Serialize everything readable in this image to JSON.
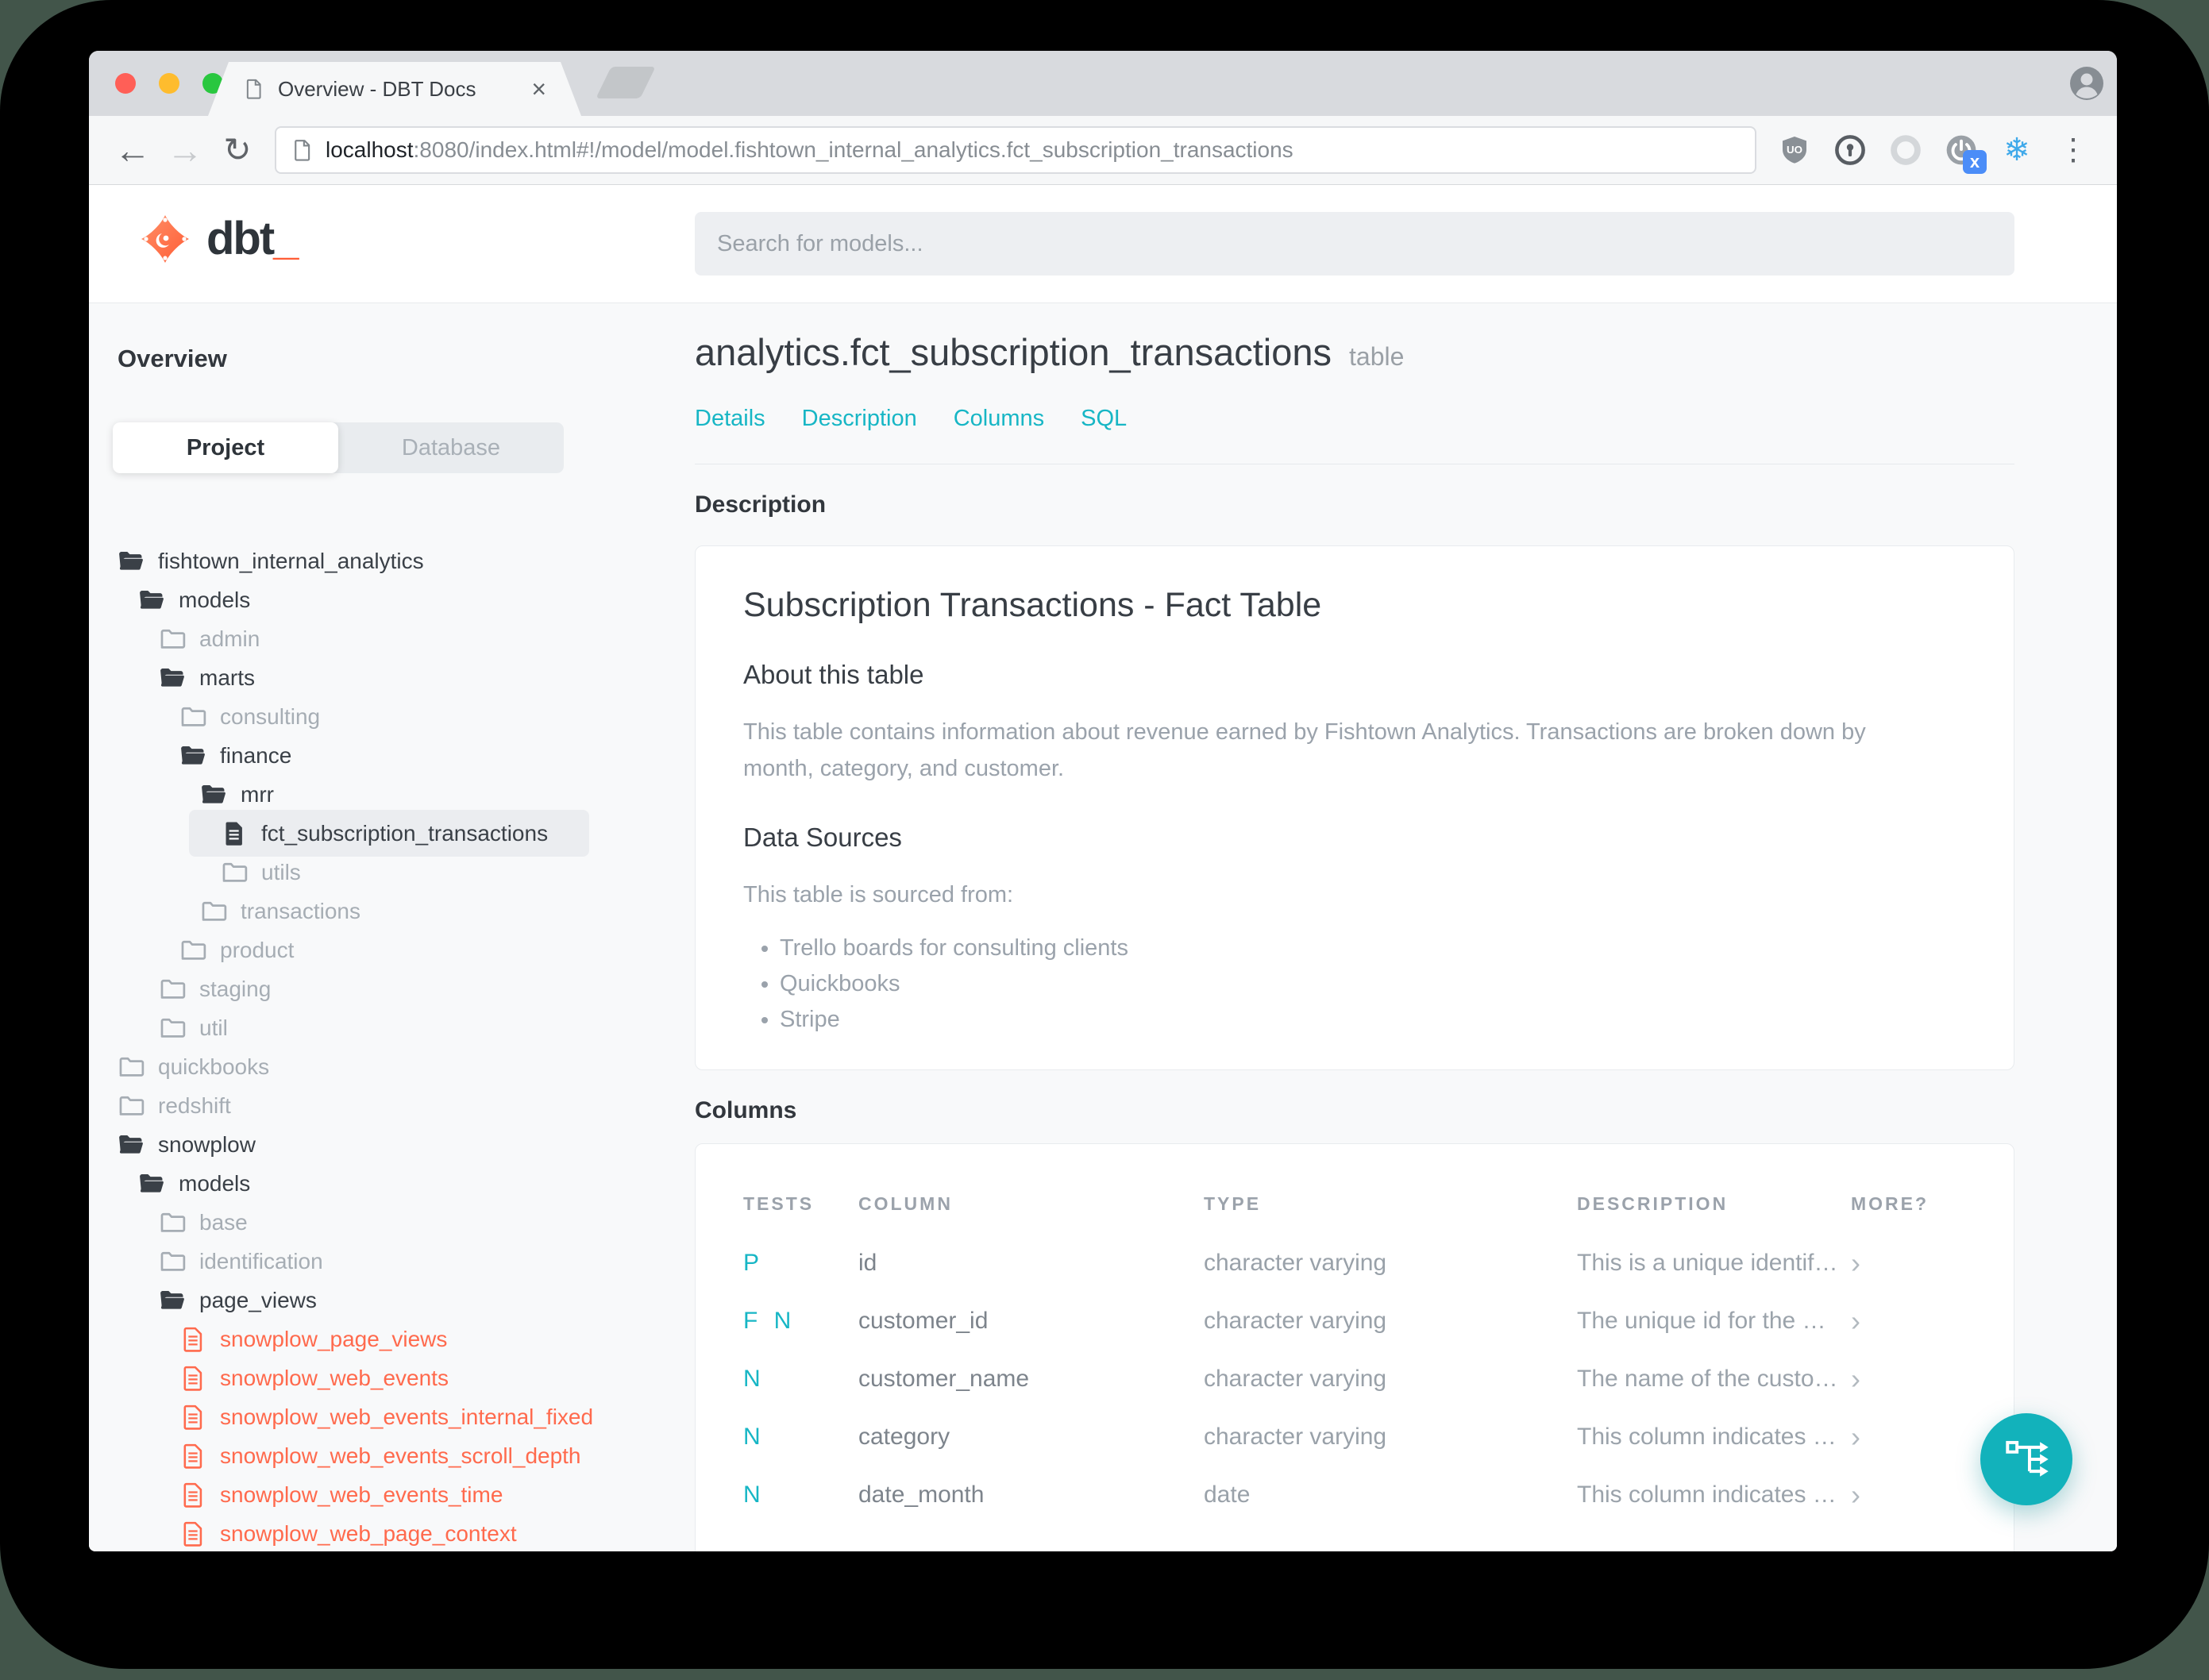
{
  "colors": {
    "accent_teal": "#17b6c5",
    "brand_orange": "#ff5c35",
    "model_red": "#ff6a4d",
    "selected_row_bg": "#ebedf0"
  },
  "icons": {
    "back": "←",
    "forward": "→",
    "reload": "↻",
    "tab_close": "×",
    "menu": "⋮",
    "snowflake": "❄",
    "row_chevron": "›",
    "ext_badge": "x",
    "ublock_label": "UO"
  },
  "browser": {
    "tab_title": "Overview - DBT Docs",
    "url_host": "localhost",
    "url_rest": ":8080/index.html#!/model/model.fishtown_internal_analytics.fct_subscription_transactions"
  },
  "header": {
    "logo_text": "dbt",
    "logo_underscore": "_",
    "search_placeholder": "Search for models..."
  },
  "sidebar": {
    "overview_label": "Overview",
    "tabs": {
      "project": "Project",
      "database": "Database"
    },
    "tree": [
      {
        "label": "fishtown_internal_analytics",
        "icon": "folder-open",
        "level": 0
      },
      {
        "label": "models",
        "icon": "folder-open",
        "level": 1
      },
      {
        "label": "admin",
        "icon": "folder-closed",
        "level": 2
      },
      {
        "label": "marts",
        "icon": "folder-open",
        "level": 2
      },
      {
        "label": "consulting",
        "icon": "folder-closed",
        "level": 3
      },
      {
        "label": "finance",
        "icon": "folder-open",
        "level": 3
      },
      {
        "label": "mrr",
        "icon": "folder-open",
        "level": 4
      },
      {
        "label": "fct_subscription_transactions",
        "icon": "file",
        "level": 5,
        "selected": true
      },
      {
        "label": "utils",
        "icon": "folder-closed",
        "level": 5
      },
      {
        "label": "transactions",
        "icon": "folder-closed",
        "level": 4
      },
      {
        "label": "product",
        "icon": "folder-closed",
        "level": 3
      },
      {
        "label": "staging",
        "icon": "folder-closed",
        "level": 2
      },
      {
        "label": "util",
        "icon": "folder-closed",
        "level": 2
      },
      {
        "label": "quickbooks",
        "icon": "folder-closed",
        "level": 0
      },
      {
        "label": "redshift",
        "icon": "folder-closed",
        "level": 0
      },
      {
        "label": "snowplow",
        "icon": "folder-open",
        "level": 0
      },
      {
        "label": "models",
        "icon": "folder-open",
        "level": 1
      },
      {
        "label": "base",
        "icon": "folder-closed",
        "level": 2
      },
      {
        "label": "identification",
        "icon": "folder-closed",
        "level": 2
      },
      {
        "label": "page_views",
        "icon": "folder-open",
        "level": 2
      },
      {
        "label": "snowplow_page_views",
        "icon": "file-red",
        "level": 3
      },
      {
        "label": "snowplow_web_events",
        "icon": "file-red",
        "level": 3
      },
      {
        "label": "snowplow_web_events_internal_fixed",
        "icon": "file-red",
        "level": 3
      },
      {
        "label": "snowplow_web_events_scroll_depth",
        "icon": "file-red",
        "level": 3
      },
      {
        "label": "snowplow_web_events_time",
        "icon": "file-red",
        "level": 3
      },
      {
        "label": "snowplow_web_page_context",
        "icon": "file-red",
        "level": 3
      }
    ]
  },
  "main": {
    "title": "analytics.fct_subscription_transactions",
    "title_badge": "table",
    "nav_tabs": [
      "Details",
      "Description",
      "Columns",
      "SQL"
    ],
    "description_section": {
      "heading": "Description",
      "card_title": "Subscription Transactions - Fact Table",
      "about_heading": "About this table",
      "about_text": "This table contains information about revenue earned by Fishtown Analytics. Transactions are broken down by month, category, and customer.",
      "sources_heading": "Data Sources",
      "sources_intro": "This table is sourced from:",
      "sources": [
        "Trello boards for consulting clients",
        "Quickbooks",
        "Stripe"
      ]
    },
    "columns_section": {
      "heading": "Columns",
      "table_headers": [
        "TESTS",
        "COLUMN",
        "TYPE",
        "DESCRIPTION",
        "MORE?"
      ],
      "rows": [
        {
          "tests": "P",
          "column": "id",
          "type": "character varying",
          "description": "This is a unique identif…"
        },
        {
          "tests": "F N",
          "column": "customer_id",
          "type": "character varying",
          "description": "The unique id for the …"
        },
        {
          "tests": "N",
          "column": "customer_name",
          "type": "character varying",
          "description": "The name of the custo…"
        },
        {
          "tests": "N",
          "column": "category",
          "type": "character varying",
          "description": "This column indicates …"
        },
        {
          "tests": "N",
          "column": "date_month",
          "type": "date",
          "description": "This column indicates …"
        }
      ]
    }
  }
}
